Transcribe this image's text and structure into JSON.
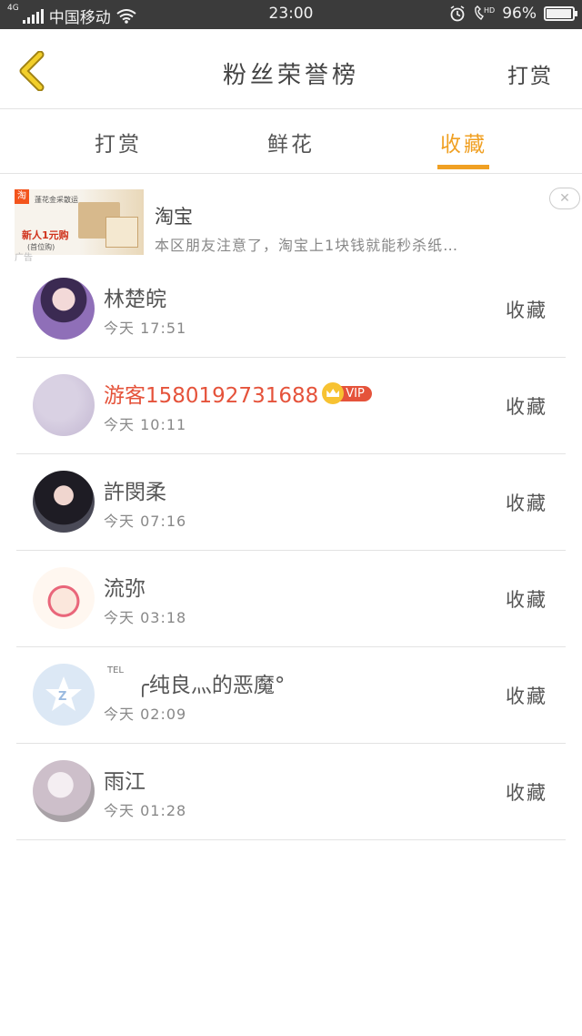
{
  "status_bar": {
    "network": "4G",
    "carrier": "中国移动",
    "time": "23:00",
    "battery": "96%",
    "battery_level": 0.96,
    "icons": [
      "signal-icon",
      "wifi-icon",
      "alarm-icon",
      "hd-call-icon",
      "battery-icon"
    ]
  },
  "header": {
    "back_icon": "chevron-left-icon",
    "title": "粉丝荣誉榜",
    "right_action": "打赏"
  },
  "tabs": [
    {
      "label": "打赏",
      "active": false
    },
    {
      "label": "鲜花",
      "active": false
    },
    {
      "label": "收藏",
      "active": true
    }
  ],
  "ad": {
    "brand": "淘宝",
    "description": "本区朋友注意了，淘宝上1块钱就能秒杀纸…",
    "tag": "广告",
    "image_logo": "淘",
    "image_line1": "蓬花金采散运",
    "image_promo": "新人1元购",
    "image_sub": "(首位购)",
    "close_icon": "close-icon"
  },
  "list": [
    {
      "name": "林楚皖",
      "time": "今天 17:51",
      "action": "收藏",
      "vip": false,
      "avatar_color": "#6b4d8a"
    },
    {
      "name": "游客15801927316​88",
      "time": "今天 10:11",
      "action": "收藏",
      "vip": true,
      "vip_label": "VIP",
      "avatar_color": "#c9bfd6"
    },
    {
      "name": "許閔柔",
      "time": "今天 07:16",
      "action": "收藏",
      "vip": false,
      "avatar_color": "#2b2b33"
    },
    {
      "name": "流弥",
      "time": "今天 03:18",
      "action": "收藏",
      "vip": false,
      "avatar_color": "#f6e6da"
    },
    {
      "name": "╭纯良灬的恶魔°",
      "time": "今天 02:09",
      "action": "收藏",
      "vip": false,
      "tel": "TEL",
      "avatar_color": "#dce8f5"
    },
    {
      "name": "雨江",
      "time": "今天 01:28",
      "action": "收藏",
      "vip": false,
      "avatar_color": "#d9d3d8"
    }
  ],
  "colors": {
    "accent": "#f0a023",
    "vip": "#e5533b",
    "status_bar": "#3b3b3b"
  }
}
